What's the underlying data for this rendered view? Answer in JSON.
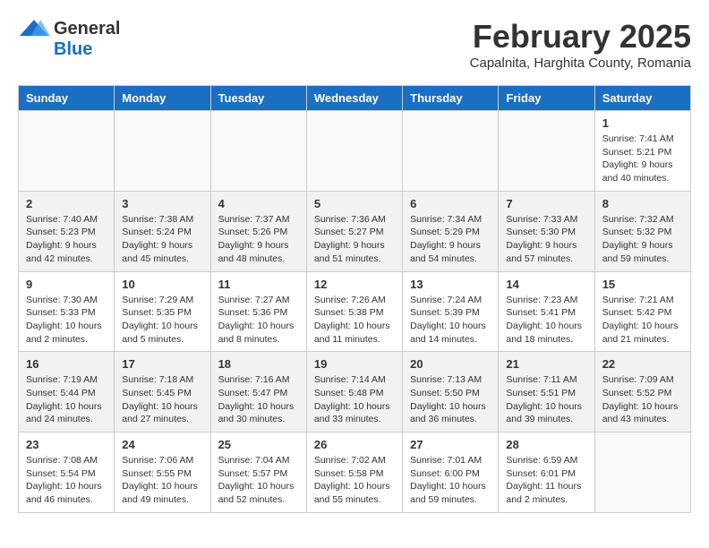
{
  "header": {
    "logo": {
      "general": "General",
      "blue": "Blue"
    },
    "month": "February 2025",
    "location": "Capalnita, Harghita County, Romania"
  },
  "days_of_week": [
    "Sunday",
    "Monday",
    "Tuesday",
    "Wednesday",
    "Thursday",
    "Friday",
    "Saturday"
  ],
  "weeks": [
    [
      {
        "day": "",
        "info": ""
      },
      {
        "day": "",
        "info": ""
      },
      {
        "day": "",
        "info": ""
      },
      {
        "day": "",
        "info": ""
      },
      {
        "day": "",
        "info": ""
      },
      {
        "day": "",
        "info": ""
      },
      {
        "day": "1",
        "info": "Sunrise: 7:41 AM\nSunset: 5:21 PM\nDaylight: 9 hours and 40 minutes."
      }
    ],
    [
      {
        "day": "2",
        "info": "Sunrise: 7:40 AM\nSunset: 5:23 PM\nDaylight: 9 hours and 42 minutes."
      },
      {
        "day": "3",
        "info": "Sunrise: 7:38 AM\nSunset: 5:24 PM\nDaylight: 9 hours and 45 minutes."
      },
      {
        "day": "4",
        "info": "Sunrise: 7:37 AM\nSunset: 5:26 PM\nDaylight: 9 hours and 48 minutes."
      },
      {
        "day": "5",
        "info": "Sunrise: 7:36 AM\nSunset: 5:27 PM\nDaylight: 9 hours and 51 minutes."
      },
      {
        "day": "6",
        "info": "Sunrise: 7:34 AM\nSunset: 5:29 PM\nDaylight: 9 hours and 54 minutes."
      },
      {
        "day": "7",
        "info": "Sunrise: 7:33 AM\nSunset: 5:30 PM\nDaylight: 9 hours and 57 minutes."
      },
      {
        "day": "8",
        "info": "Sunrise: 7:32 AM\nSunset: 5:32 PM\nDaylight: 9 hours and 59 minutes."
      }
    ],
    [
      {
        "day": "9",
        "info": "Sunrise: 7:30 AM\nSunset: 5:33 PM\nDaylight: 10 hours and 2 minutes."
      },
      {
        "day": "10",
        "info": "Sunrise: 7:29 AM\nSunset: 5:35 PM\nDaylight: 10 hours and 5 minutes."
      },
      {
        "day": "11",
        "info": "Sunrise: 7:27 AM\nSunset: 5:36 PM\nDaylight: 10 hours and 8 minutes."
      },
      {
        "day": "12",
        "info": "Sunrise: 7:26 AM\nSunset: 5:38 PM\nDaylight: 10 hours and 11 minutes."
      },
      {
        "day": "13",
        "info": "Sunrise: 7:24 AM\nSunset: 5:39 PM\nDaylight: 10 hours and 14 minutes."
      },
      {
        "day": "14",
        "info": "Sunrise: 7:23 AM\nSunset: 5:41 PM\nDaylight: 10 hours and 18 minutes."
      },
      {
        "day": "15",
        "info": "Sunrise: 7:21 AM\nSunset: 5:42 PM\nDaylight: 10 hours and 21 minutes."
      }
    ],
    [
      {
        "day": "16",
        "info": "Sunrise: 7:19 AM\nSunset: 5:44 PM\nDaylight: 10 hours and 24 minutes."
      },
      {
        "day": "17",
        "info": "Sunrise: 7:18 AM\nSunset: 5:45 PM\nDaylight: 10 hours and 27 minutes."
      },
      {
        "day": "18",
        "info": "Sunrise: 7:16 AM\nSunset: 5:47 PM\nDaylight: 10 hours and 30 minutes."
      },
      {
        "day": "19",
        "info": "Sunrise: 7:14 AM\nSunset: 5:48 PM\nDaylight: 10 hours and 33 minutes."
      },
      {
        "day": "20",
        "info": "Sunrise: 7:13 AM\nSunset: 5:50 PM\nDaylight: 10 hours and 36 minutes."
      },
      {
        "day": "21",
        "info": "Sunrise: 7:11 AM\nSunset: 5:51 PM\nDaylight: 10 hours and 39 minutes."
      },
      {
        "day": "22",
        "info": "Sunrise: 7:09 AM\nSunset: 5:52 PM\nDaylight: 10 hours and 43 minutes."
      }
    ],
    [
      {
        "day": "23",
        "info": "Sunrise: 7:08 AM\nSunset: 5:54 PM\nDaylight: 10 hours and 46 minutes."
      },
      {
        "day": "24",
        "info": "Sunrise: 7:06 AM\nSunset: 5:55 PM\nDaylight: 10 hours and 49 minutes."
      },
      {
        "day": "25",
        "info": "Sunrise: 7:04 AM\nSunset: 5:57 PM\nDaylight: 10 hours and 52 minutes."
      },
      {
        "day": "26",
        "info": "Sunrise: 7:02 AM\nSunset: 5:58 PM\nDaylight: 10 hours and 55 minutes."
      },
      {
        "day": "27",
        "info": "Sunrise: 7:01 AM\nSunset: 6:00 PM\nDaylight: 10 hours and 59 minutes."
      },
      {
        "day": "28",
        "info": "Sunrise: 6:59 AM\nSunset: 6:01 PM\nDaylight: 11 hours and 2 minutes."
      },
      {
        "day": "",
        "info": ""
      }
    ]
  ]
}
